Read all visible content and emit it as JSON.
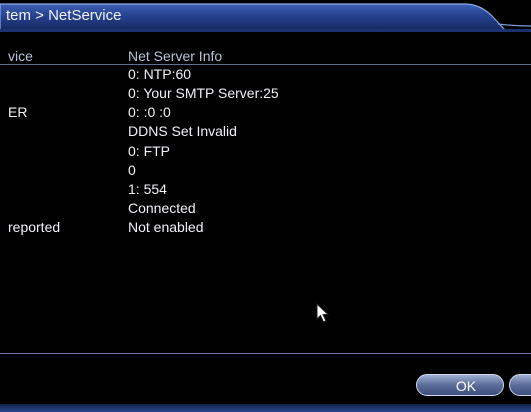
{
  "window": {
    "title": "tem > NetService"
  },
  "table": {
    "columns": [
      "vice",
      "Net Server Info"
    ],
    "rows": [
      {
        "name": "",
        "info": "0: NTP:60"
      },
      {
        "name": "",
        "info": "0: Your SMTP Server:25"
      },
      {
        "name": "ER",
        "info": "0: :0 :0"
      },
      {
        "name": "",
        "info": "DDNS Set Invalid"
      },
      {
        "name": "",
        "info": "0: FTP"
      },
      {
        "name": "",
        "info": "0"
      },
      {
        "name": "",
        "info": "1: 554"
      },
      {
        "name": "",
        "info": "Connected"
      },
      {
        "name": "reported",
        "info": "Not enabled"
      }
    ]
  },
  "buttons": {
    "ok_label": "OK",
    "cancel_label": "C"
  },
  "icons": {
    "cursor": "mouse-pointer-icon"
  },
  "colors": {
    "title_bar": "#2a4a9a",
    "title_bar_edge": "#6c8fd8",
    "background": "#000000",
    "button": "#5a6c98"
  }
}
